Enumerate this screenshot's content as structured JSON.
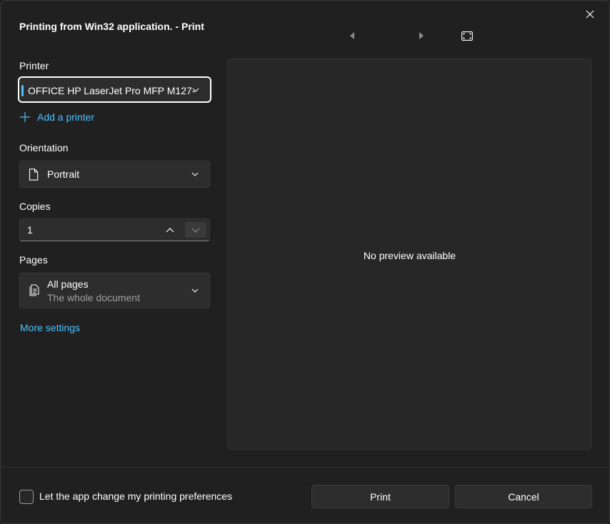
{
  "window": {
    "title": "Printing from Win32 application. - Print"
  },
  "printer": {
    "label": "Printer",
    "selected": "OFFICE HP LaserJet Pro MFP M127-",
    "add_printer": "Add a printer"
  },
  "orientation": {
    "label": "Orientation",
    "selected": "Portrait"
  },
  "copies": {
    "label": "Copies",
    "value": "1"
  },
  "pages": {
    "label": "Pages",
    "selected": "All pages",
    "description": "The whole document"
  },
  "more_settings": "More settings",
  "preview": {
    "message": "No preview available"
  },
  "footer": {
    "checkbox_label": "Let the app change my printing preferences",
    "print_label": "Print",
    "cancel_label": "Cancel"
  },
  "colors": {
    "accent": "#4cc2ff",
    "background": "#202020",
    "control": "#2d2d2d"
  },
  "icons": [
    "close-icon",
    "previous-page-icon",
    "next-page-icon",
    "fit-to-window-icon",
    "chevron-down-icon",
    "plus-icon",
    "document-icon",
    "chevron-up-icon",
    "pages-icon"
  ]
}
